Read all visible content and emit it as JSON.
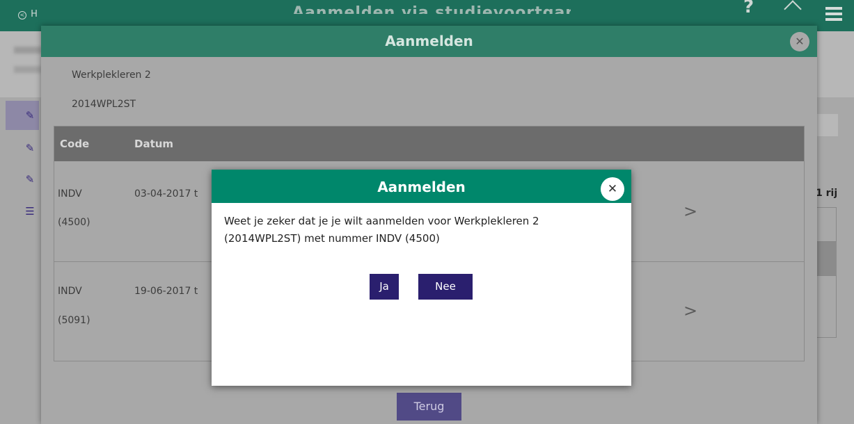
{
  "app": {
    "back_label": "H",
    "title": "Aanmelden via studievoortgang",
    "help_label": "?"
  },
  "right_panel": {
    "rows_label": "1 rij"
  },
  "modal": {
    "title": "Aanmelden",
    "course_name": "Werkplekleren 2",
    "course_code": "2014WPL2ST",
    "table": {
      "columns": [
        "Code",
        "Datum"
      ],
      "rows": [
        {
          "code": "INDV",
          "number": "(4500)",
          "date": "03-04-2017 t"
        },
        {
          "code": "INDV",
          "number": "(5091)",
          "date": "19-06-2017 t"
        }
      ]
    },
    "back_button": "Terug"
  },
  "dialog": {
    "title": "Aanmelden",
    "message": "Weet je zeker dat je je wilt aanmelden voor Werkplekleren 2 (2014WPL2ST) met nummer INDV (4500)",
    "yes_label": "Ja",
    "no_label": "Nee"
  },
  "icons": {
    "close": "close-icon",
    "chevron": "chevron-right-icon",
    "edit": "edit-icon",
    "list": "list-icon"
  },
  "colors": {
    "header_green": "#00876b",
    "button_purple": "#2a1f6e",
    "overlay_gray": "#a8a8a8"
  }
}
